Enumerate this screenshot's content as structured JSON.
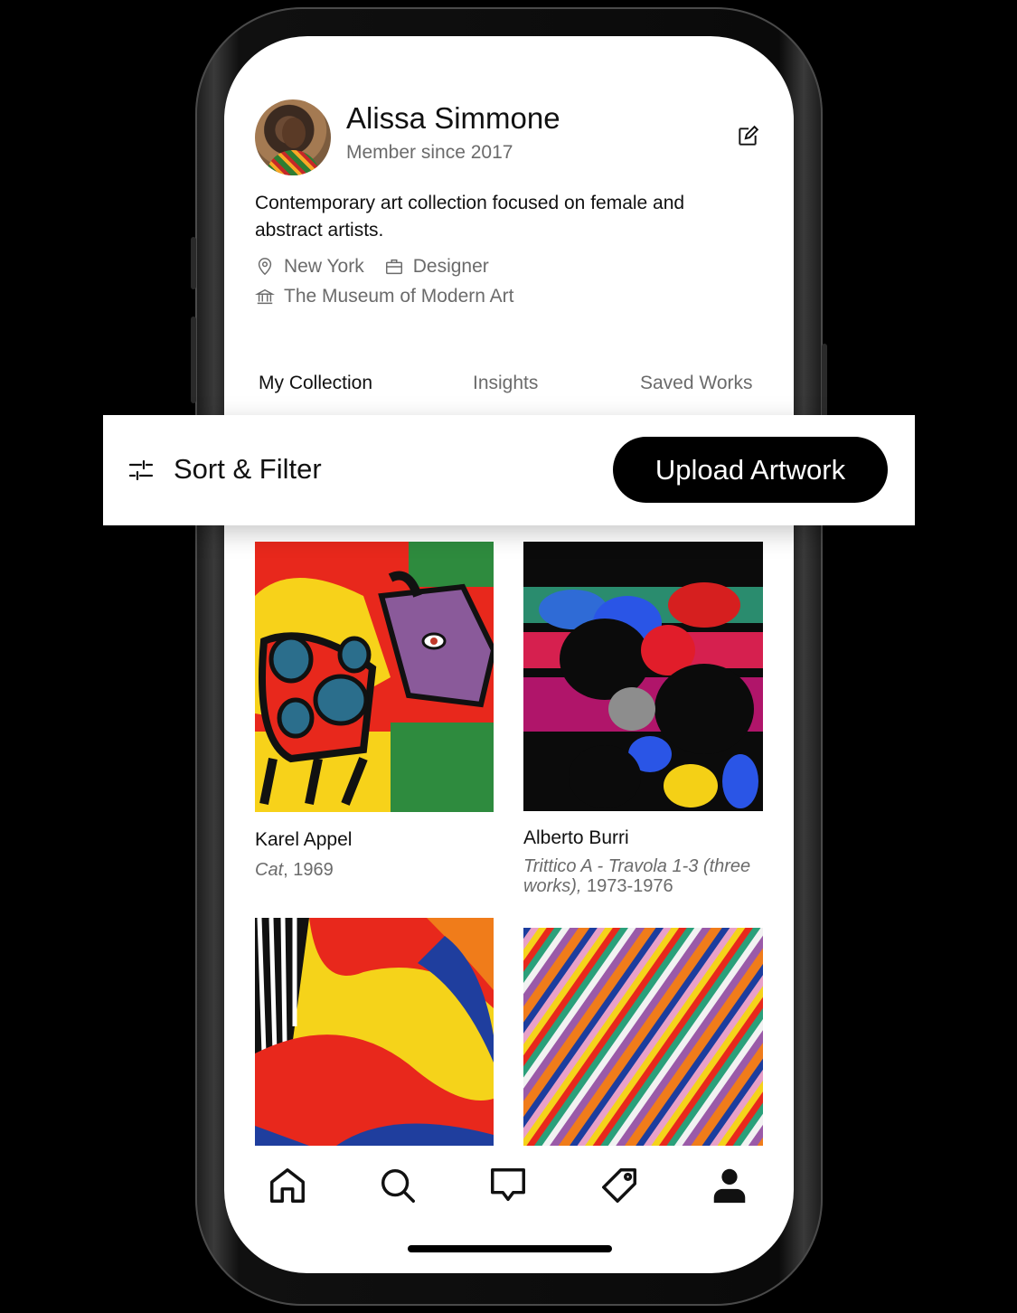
{
  "profile": {
    "name": "Alissa Simmone",
    "member_since": "Member since 2017",
    "bio": "Contemporary art collection focused on female and abstract artists.",
    "location": "New York",
    "occupation": "Designer",
    "institution": "The Museum of Modern Art",
    "edit_icon": "edit-icon"
  },
  "tabs": [
    {
      "label": "My Collection",
      "active": true
    },
    {
      "label": "Insights",
      "active": false
    },
    {
      "label": "Saved Works",
      "active": false
    }
  ],
  "toolbar": {
    "sort_filter_label": "Sort & Filter",
    "upload_label": "Upload Artwork"
  },
  "artworks": [
    {
      "artist": "Karel Appel",
      "title": "Cat",
      "year": ", 1969"
    },
    {
      "artist": "Alberto Burri",
      "title": "Trittico A - Travola 1-3 (three works),",
      "year": " 1973-1976"
    },
    {
      "artist": "",
      "title": "",
      "year": ""
    },
    {
      "artist": "",
      "title": "",
      "year": ""
    }
  ],
  "nav": [
    "home-icon",
    "search-icon",
    "messages-icon",
    "tag-icon",
    "profile-icon"
  ],
  "colors": {
    "accent": "#000000",
    "muted_text": "#6b6b6b",
    "background": "#ffffff"
  }
}
